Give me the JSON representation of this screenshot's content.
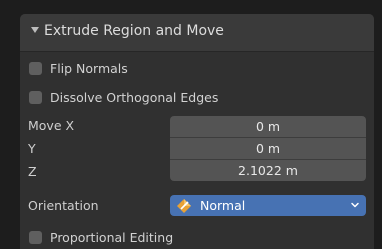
{
  "panel": {
    "title": "Extrude Region and Move",
    "expanded": true,
    "flip_normals": {
      "label": "Flip Normals",
      "checked": false
    },
    "dissolve_orthogonal_edges": {
      "label": "Dissolve Orthogonal Edges",
      "checked": false
    },
    "move": {
      "x_label": "Move X",
      "y_label": "Y",
      "z_label": "Z",
      "x_value": "0 m",
      "y_value": "0 m",
      "z_value": "2.1022 m"
    },
    "orientation": {
      "label": "Orientation",
      "value": "Normal",
      "icon": "normal-orientation-icon"
    },
    "proportional_editing": {
      "label": "Proportional Editing",
      "checked": false
    }
  },
  "colors": {
    "panel_bg": "#303030",
    "header_bg": "#3a3a3a",
    "field_bg": "#545454",
    "accent": "#4772b3",
    "checkbox": "#5f5f5f",
    "icon_orange": "#e8a136"
  }
}
